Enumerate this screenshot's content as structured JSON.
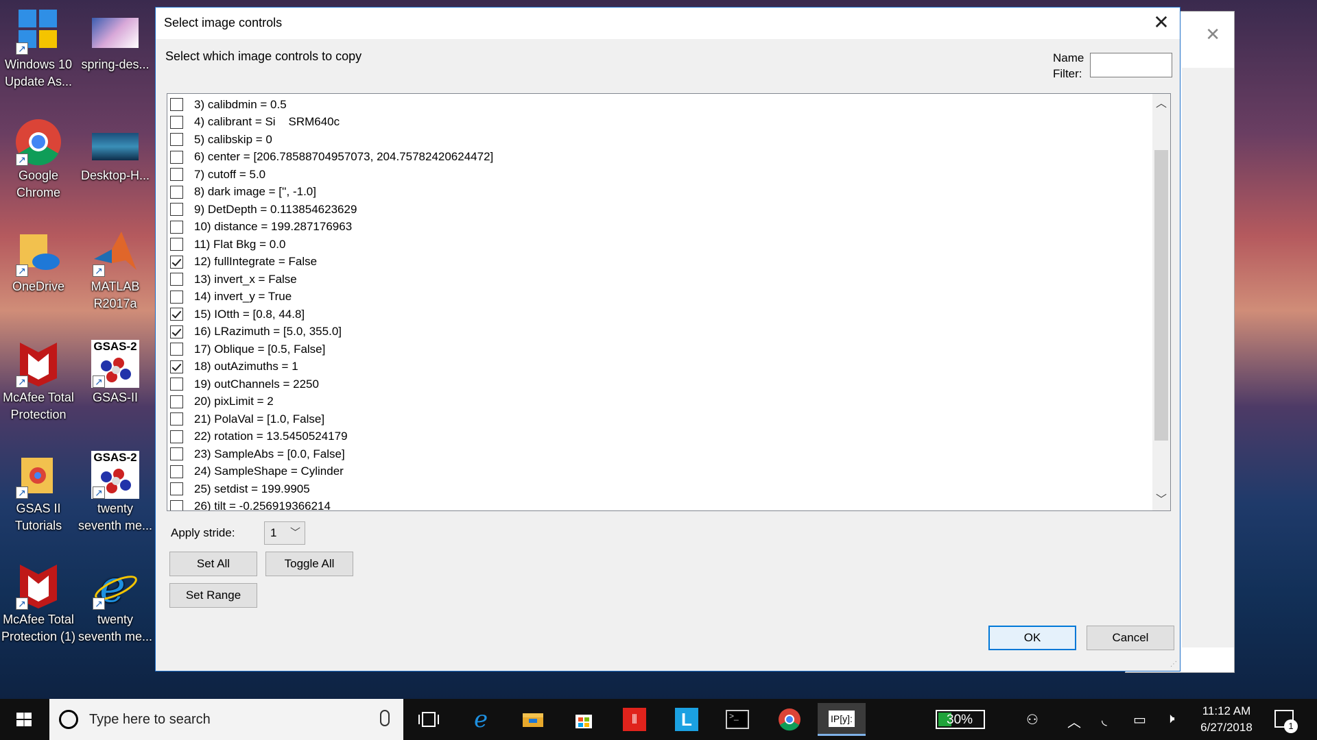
{
  "desktop": {
    "icons": [
      {
        "label": "Windows 10 Update As...",
        "icon": "windows-update-icon"
      },
      {
        "label": "spring-des...",
        "icon": "image-file-icon"
      },
      {
        "label": "Google Chrome",
        "icon": "chrome-icon"
      },
      {
        "label": "Desktop-H...",
        "icon": "image-file-icon"
      },
      {
        "label": "OneDrive",
        "icon": "onedrive-icon"
      },
      {
        "label": "MATLAB R2017a",
        "icon": "matlab-icon"
      },
      {
        "label": "McAfee Total Protection",
        "icon": "mcafee-icon"
      },
      {
        "label": "GSAS-II",
        "icon": "gsas-icon"
      },
      {
        "label": "GSAS II Tutorials",
        "icon": "folder-icon"
      },
      {
        "label": "twenty seventh me...",
        "icon": "gsas-icon"
      },
      {
        "label": "McAfee Total Protection (1)",
        "icon": "mcafee-icon"
      },
      {
        "label": "twenty seventh me...",
        "icon": "internet-explorer-icon"
      }
    ],
    "gsas_badge": "GSAS-2"
  },
  "dialog": {
    "title": "Select image controls",
    "prompt": "Select which image controls to copy",
    "filter_label": "Name Filter:",
    "filter_value": "",
    "items": [
      {
        "label": "3) calibdmin = 0.5",
        "checked": false
      },
      {
        "label": "4) calibrant = Si    SRM640c",
        "checked": false
      },
      {
        "label": "5) calibskip = 0",
        "checked": false
      },
      {
        "label": "6) center = [206.78588704957073, 204.75782420624472]",
        "checked": false
      },
      {
        "label": "7) cutoff = 5.0",
        "checked": false
      },
      {
        "label": "8) dark image = ['', -1.0]",
        "checked": false
      },
      {
        "label": "9) DetDepth = 0.113854623629",
        "checked": false
      },
      {
        "label": "10) distance = 199.287176963",
        "checked": false
      },
      {
        "label": "11) Flat Bkg = 0.0",
        "checked": false
      },
      {
        "label": "12) fullIntegrate = False",
        "checked": true
      },
      {
        "label": "13) invert_x = False",
        "checked": false
      },
      {
        "label": "14) invert_y = True",
        "checked": false
      },
      {
        "label": "15) IOtth = [0.8, 44.8]",
        "checked": true
      },
      {
        "label": "16) LRazimuth = [5.0, 355.0]",
        "checked": true
      },
      {
        "label": "17) Oblique = [0.5, False]",
        "checked": false
      },
      {
        "label": "18) outAzimuths = 1",
        "checked": true
      },
      {
        "label": "19) outChannels = 2250",
        "checked": false
      },
      {
        "label": "20) pixLimit = 2",
        "checked": false
      },
      {
        "label": "21) PolaVal = [1.0, False]",
        "checked": false
      },
      {
        "label": "22) rotation = 13.5450524179",
        "checked": false
      },
      {
        "label": "23) SampleAbs = [0.0, False]",
        "checked": false
      },
      {
        "label": "24) SampleShape = Cylinder",
        "checked": false
      },
      {
        "label": "25) setdist = 199.9905",
        "checked": false
      },
      {
        "label": "26) tilt = -0.256919366214",
        "checked": false
      }
    ],
    "stride_label": "Apply stride:",
    "stride_value": "1",
    "set_all": "Set All",
    "toggle_all": "Toggle All",
    "set_range": "Set Range",
    "ok": "OK",
    "cancel": "Cancel"
  },
  "taskbar": {
    "search_placeholder": "Type here to search",
    "battery": "30%",
    "time": "11:12 AM",
    "date": "6/27/2018",
    "notifications": "1",
    "apps": [
      "task-view-icon",
      "edge-icon",
      "file-explorer-icon",
      "store-icon",
      "app-red-icon",
      "app-l-icon",
      "terminal-icon",
      "chrome-icon",
      "ipython-icon"
    ],
    "ipython_label": "IP[y]:"
  },
  "colors": {
    "accent": "#0078d7",
    "battery_fill": "#1fa33a"
  }
}
